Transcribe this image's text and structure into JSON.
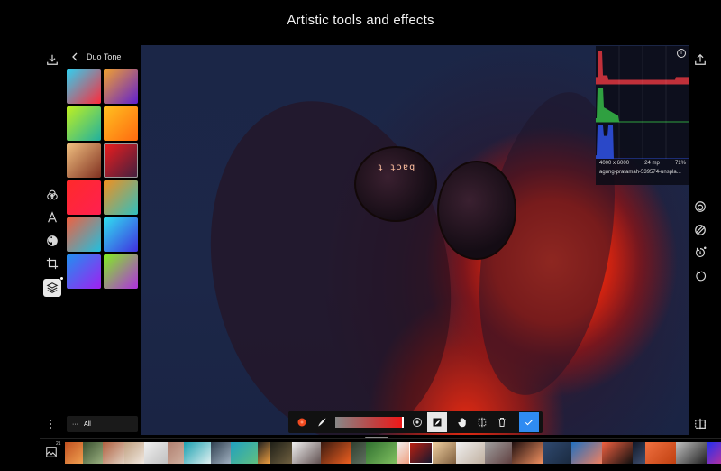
{
  "page": {
    "title": "Artistic tools and effects"
  },
  "left_rail": {
    "top": [
      {
        "icon": "download-icon",
        "name": "download-button"
      }
    ],
    "tools": [
      {
        "icon": "filters-icon",
        "name": "filters-tool"
      },
      {
        "icon": "text-icon",
        "name": "text-tool"
      },
      {
        "icon": "mask-icon",
        "name": "mask-tool"
      },
      {
        "icon": "crop-icon",
        "name": "crop-tool"
      },
      {
        "icon": "layers-icon",
        "name": "layers-tool",
        "active": true
      }
    ],
    "more": {
      "icon": "more-vertical-icon",
      "label": "⋮"
    }
  },
  "preset_panel": {
    "back_icon": "chevron-left-icon",
    "title": "Duo Tone",
    "swatches": [
      {
        "name": "Duo 1",
        "from": "#ff2a3a",
        "to": "#30d0f0"
      },
      {
        "name": "Duo 2",
        "from": "#6020d0",
        "to": "#f0a030"
      },
      {
        "name": "Duo 3",
        "from": "#20b0a0",
        "to": "#c0f020"
      },
      {
        "name": "Duo 4",
        "from": "#ff6a10",
        "to": "#ffc020"
      },
      {
        "name": "Duo 5",
        "from": "#803020",
        "to": "#f0c080"
      },
      {
        "name": "Duo 6",
        "from": "#402040",
        "to": "#f01c1c",
        "selected": true
      },
      {
        "name": "Duo 7",
        "from": "#ff2050",
        "to": "#ff2a2a"
      },
      {
        "name": "Duo 8",
        "from": "#30c0c0",
        "to": "#f09020"
      },
      {
        "name": "Duo 9",
        "from": "#20c0e0",
        "to": "#f06040"
      },
      {
        "name": "Duo 10",
        "from": "#4030e0",
        "to": "#30e0f0"
      },
      {
        "name": "Duo 11",
        "from": "#a020f0",
        "to": "#2090f0"
      },
      {
        "name": "Duo 12",
        "from": "#b030e0",
        "to": "#80f020"
      }
    ],
    "filter": {
      "dots": "···",
      "label": "All"
    }
  },
  "histogram": {
    "info_icon": "i",
    "dimensions": "4000 x 6000",
    "megapixels": "24 mp",
    "zoom": "71%",
    "filename": "agung-pratamah-539574-unspla...",
    "channels": [
      {
        "name": "red",
        "color": "#c0303a"
      },
      {
        "name": "green",
        "color": "#2fa040"
      },
      {
        "name": "blue",
        "color": "#2a48c8"
      }
    ]
  },
  "right_rail": {
    "top": [
      {
        "icon": "share-icon",
        "name": "export-button"
      }
    ],
    "tools": [
      {
        "icon": "radial-icon",
        "name": "radial-tool"
      },
      {
        "icon": "gradient-icon",
        "name": "linear-gradient-tool"
      },
      {
        "icon": "history-icon",
        "name": "history-tool"
      },
      {
        "icon": "undo-icon",
        "name": "undo-button"
      }
    ],
    "bottom": [
      {
        "icon": "compare-icon",
        "name": "compare-button"
      }
    ]
  },
  "toolbar": {
    "color": "#f04a20",
    "gradient_from": "#888888",
    "gradient_to": "#f01818",
    "items": [
      {
        "icon": "color-picker-icon",
        "name": "color-button"
      },
      {
        "icon": "brush-icon",
        "name": "brush-button"
      },
      {
        "icon": "radius-icon",
        "name": "radius-button"
      },
      {
        "icon": "mask-invert-icon",
        "name": "invert-mask-button",
        "active": true
      },
      {
        "icon": "hand-icon",
        "name": "pan-button"
      },
      {
        "icon": "split-icon",
        "name": "split-button"
      },
      {
        "icon": "trash-icon",
        "name": "delete-button"
      },
      {
        "icon": "check-icon",
        "name": "apply-button"
      }
    ]
  },
  "filmstrip": {
    "count": "21",
    "thumbs": [
      {
        "colors": [
          "#c05020",
          "#f0a050"
        ]
      },
      {
        "colors": [
          "#3a5030",
          "#9ab080"
        ]
      },
      {
        "colors": [
          "#b06040",
          "#e0d0c0"
        ]
      },
      {
        "colors": [
          "#c0a080",
          "#f0e8e0"
        ]
      },
      {
        "colors": [
          "#f0f0f0",
          "#c0c0c0"
        ]
      },
      {
        "colors": [
          "#b08070",
          "#d0b0a0"
        ]
      },
      {
        "colors": [
          "#1aa0b0",
          "#e0f0f0"
        ]
      },
      {
        "colors": [
          "#304050",
          "#a0b0c0"
        ]
      },
      {
        "colors": [
          "#20a0c0",
          "#60c080"
        ]
      },
      {
        "colors": [
          "#202020",
          "#f0a040"
        ]
      },
      {
        "colors": [
          "#202018",
          "#706040"
        ]
      },
      {
        "colors": [
          "#f0f0f0",
          "#605050"
        ]
      },
      {
        "colors": [
          "#3a1a10",
          "#f06020"
        ]
      },
      {
        "colors": [
          "#304030",
          "#607060"
        ]
      },
      {
        "colors": [
          "#307030",
          "#80c060"
        ]
      },
      {
        "colors": [
          "#f0f0f0",
          "#f0a080"
        ]
      },
      {
        "colors": [
          "#c02010",
          "#101830"
        ],
        "selected": true
      },
      {
        "colors": [
          "#f0d0a0",
          "#806040"
        ]
      },
      {
        "colors": [
          "#f0f0f0",
          "#c0b0a0"
        ]
      },
      {
        "colors": [
          "#a0a0a0",
          "#604040"
        ]
      },
      {
        "colors": [
          "#201010",
          "#f09060"
        ]
      },
      {
        "colors": [
          "#304a70",
          "#1a2a40"
        ]
      },
      {
        "colors": [
          "#2070c0",
          "#f08060"
        ]
      },
      {
        "colors": [
          "#f06040",
          "#101010"
        ]
      },
      {
        "colors": [
          "#101828",
          "#405070"
        ]
      },
      {
        "colors": [
          "#f07040",
          "#c04010"
        ]
      },
      {
        "colors": [
          "#c0c0c0",
          "#202020"
        ]
      },
      {
        "colors": [
          "#2030f0",
          "#f03080"
        ]
      },
      {
        "colors": [
          "#20b0c0",
          "#103040"
        ]
      },
      {
        "colors": [
          "#302020",
          "#e080c0"
        ]
      }
    ]
  }
}
